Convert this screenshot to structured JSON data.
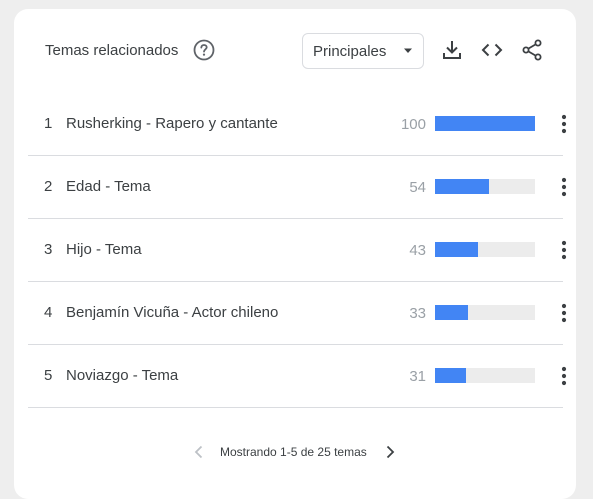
{
  "header": {
    "title": "Temas relacionados",
    "filter_selected": "Principales",
    "icons": [
      "help-icon",
      "download-icon",
      "embed-code-icon",
      "share-icon"
    ]
  },
  "colors": {
    "bar_fill": "#4285f4",
    "bar_track": "#ececec",
    "muted_value": "#9aa0a6"
  },
  "topics": [
    {
      "rank": "1",
      "name": "Rusherking - Rapero y cantante",
      "value": "100",
      "level": 100
    },
    {
      "rank": "2",
      "name": "Edad - Tema",
      "value": "54",
      "level": 54
    },
    {
      "rank": "3",
      "name": "Hijo - Tema",
      "value": "43",
      "level": 43
    },
    {
      "rank": "4",
      "name": "Benjamín Vicuña - Actor chileno",
      "value": "33",
      "level": 33
    },
    {
      "rank": "5",
      "name": "Noviazgo - Tema",
      "value": "31",
      "level": 31
    }
  ],
  "footer": {
    "paging_text": "Mostrando 1-5 de 25 temas"
  }
}
